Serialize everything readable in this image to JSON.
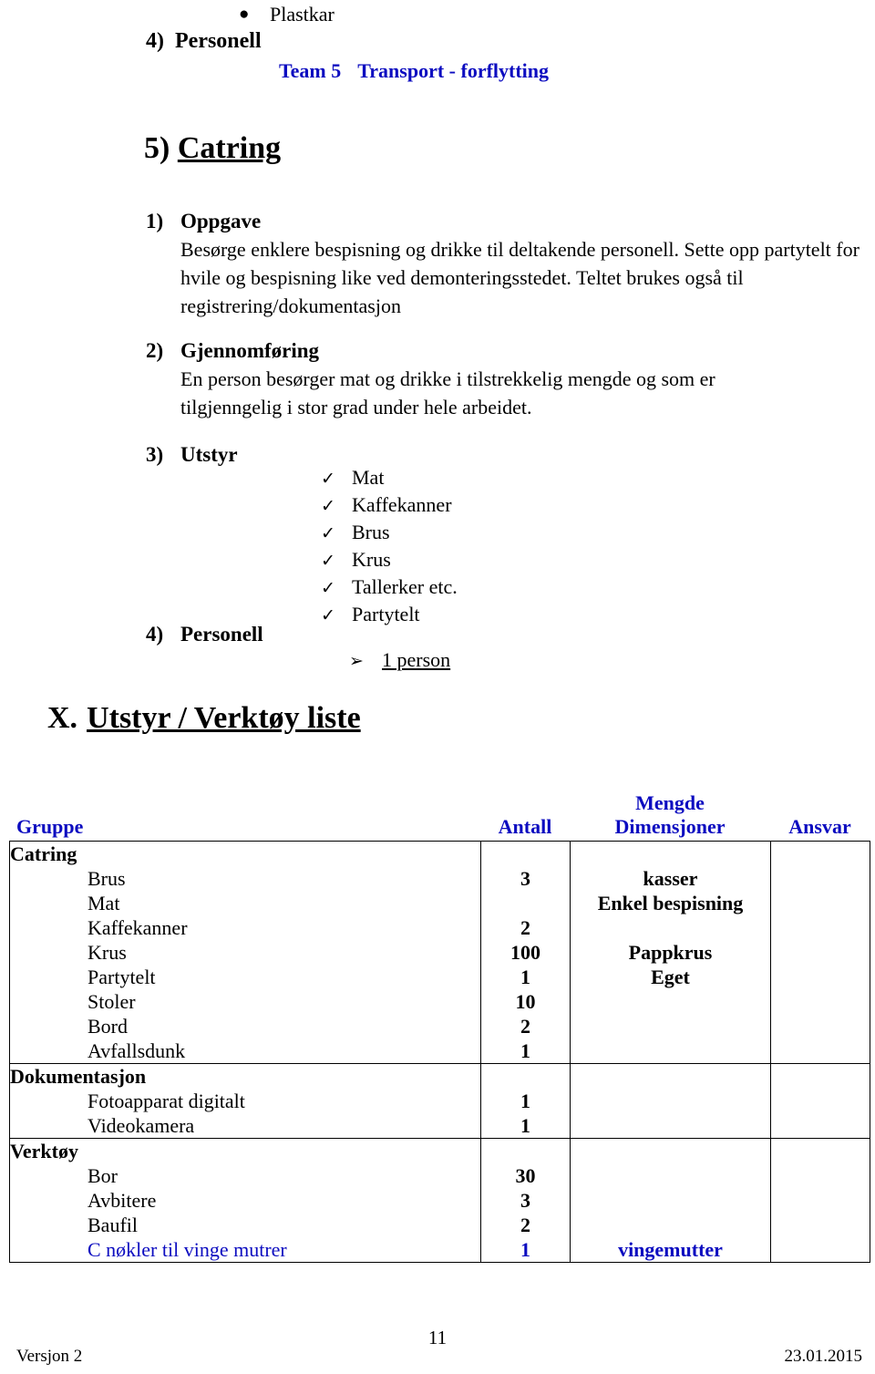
{
  "top": {
    "bullet_glyph": "●",
    "bullet_item": "Plastkar",
    "personell_number": "4)",
    "personell_label": "Personell",
    "team_name": "Team 5",
    "team_role": "Transport - forflytting"
  },
  "section": {
    "number": "5)",
    "title": "Catring"
  },
  "items": {
    "oppgave": {
      "number": "1)",
      "heading": "Oppgave",
      "body": "Besørge enklere bespisning og drikke til deltakende personell. Sette opp partytelt for hvile og bespisning like ved demonteringsstedet. Teltet brukes også til registrering/dokumentasjon"
    },
    "gjennomforing": {
      "number": "2)",
      "heading": "Gjennomføring",
      "body": "En person besørger mat og drikke i tilstrekkelig mengde og som er tilgjenngelig i stor grad under hele arbeidet."
    },
    "utstyr": {
      "number": "3)",
      "heading": "Utstyr",
      "check_glyph": "✓",
      "list": [
        "Mat",
        "Kaffekanner",
        "Brus",
        "Krus",
        "Tallerker etc.",
        "Partytelt"
      ]
    },
    "personell": {
      "number": "4)",
      "heading": "Personell",
      "arrow_glyph": "➢",
      "value": "1 person"
    }
  },
  "utstyr_liste": {
    "roman": "X.",
    "title": "Utstyr / Verktøy liste"
  },
  "table": {
    "headers": {
      "gruppe": "Gruppe",
      "antall": "Antall",
      "mengde_line1": "Mengde",
      "mengde_line2": "Dimensjoner",
      "ansvar": "Ansvar"
    },
    "groups": [
      {
        "name": "Catring",
        "rows": [
          {
            "item": "Brus",
            "antall": "3",
            "mengde": "kasser",
            "ansvar": ""
          },
          {
            "item": "Mat",
            "antall": "",
            "mengde": "Enkel bespisning",
            "ansvar": ""
          },
          {
            "item": "Kaffekanner",
            "antall": "2",
            "mengde": "",
            "ansvar": ""
          },
          {
            "item": "Krus",
            "antall": "100",
            "mengde": "Pappkrus",
            "ansvar": ""
          },
          {
            "item": "Partytelt",
            "antall": "1",
            "mengde": "Eget",
            "ansvar": ""
          },
          {
            "item": "Stoler",
            "antall": "10",
            "mengde": "",
            "ansvar": ""
          },
          {
            "item": "Bord",
            "antall": "2",
            "mengde": "",
            "ansvar": ""
          },
          {
            "item": "Avfallsdunk",
            "antall": "1",
            "mengde": "",
            "ansvar": ""
          }
        ]
      },
      {
        "name": "Dokumentasjon",
        "rows": [
          {
            "item": "Fotoapparat digitalt",
            "antall": "1",
            "mengde": "",
            "ansvar": ""
          },
          {
            "item": "Videokamera",
            "antall": "1",
            "mengde": "",
            "ansvar": ""
          }
        ]
      },
      {
        "name": "Verktøy",
        "rows": [
          {
            "item": "Bor",
            "antall": "30",
            "mengde": "",
            "ansvar": ""
          },
          {
            "item": "Avbitere",
            "antall": "3",
            "mengde": "",
            "ansvar": ""
          },
          {
            "item": "Baufil",
            "antall": "2",
            "mengde": "",
            "ansvar": ""
          },
          {
            "item": "C nøkler til vinge mutrer",
            "antall": "1",
            "mengde": "vingemutter",
            "ansvar": "",
            "blue": true
          }
        ]
      }
    ]
  },
  "footer": {
    "version": "Versjon 2",
    "page_number": "11",
    "date": "23.01.2015"
  },
  "colors": {
    "accent_blue": "#0c0cc0",
    "text": "#000000",
    "border": "#000000"
  }
}
